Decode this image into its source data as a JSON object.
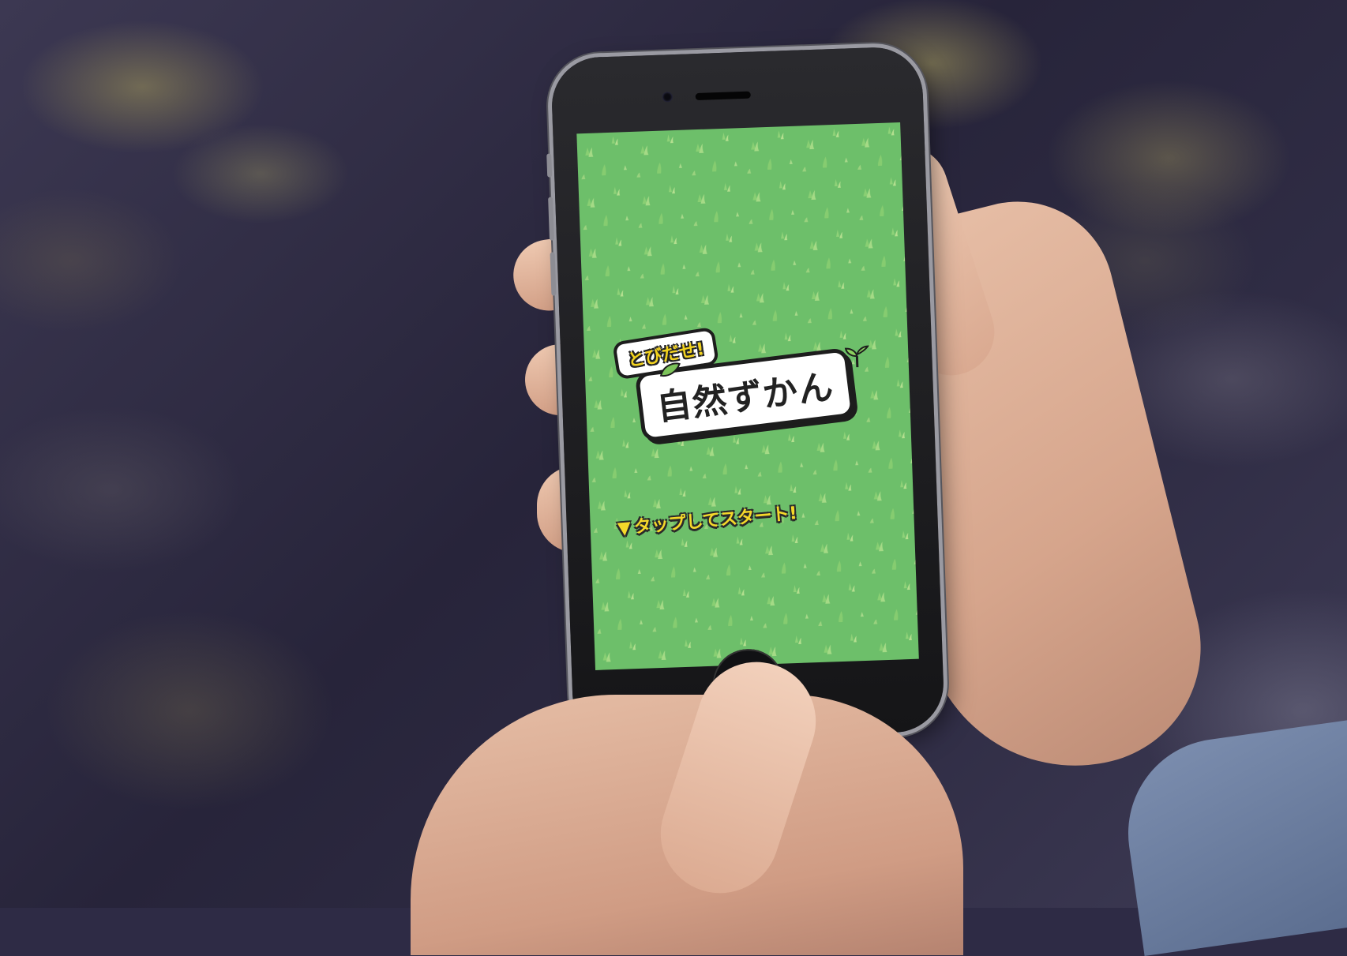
{
  "app": {
    "logo_subtitle": "とびだせ!",
    "logo_title": "自然ずかん",
    "tap_prompt": "タップしてスタート!",
    "tap_arrow_glyph": "▼"
  },
  "colors": {
    "screen_bg": "#6dbf6a",
    "accent_yellow": "#f2d21e",
    "outline": "#1d1d1d"
  },
  "icons": [
    "leaf-icon",
    "sprout-icon",
    "triangle-down-icon",
    "grass-pattern"
  ]
}
